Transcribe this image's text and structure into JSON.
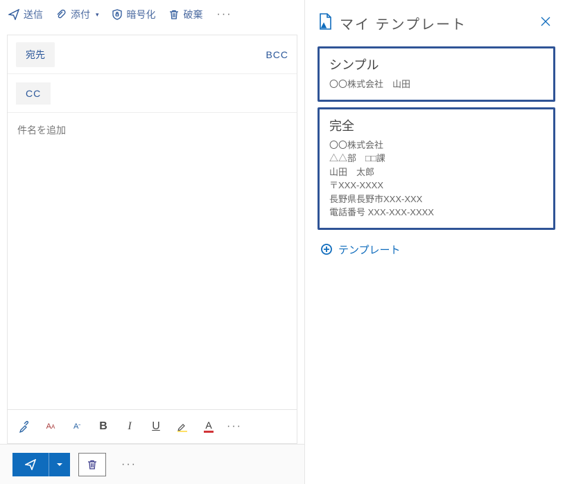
{
  "toolbar": {
    "send": "送信",
    "attach": "添付",
    "encrypt": "暗号化",
    "discard": "破棄"
  },
  "recipients": {
    "to_label": "宛先",
    "bcc_label": "BCC",
    "cc_label": "CC"
  },
  "subject_placeholder": "件名を追加",
  "format_buttons": {
    "bold": "B",
    "italic": "I",
    "underline": "U"
  },
  "templates_panel": {
    "title": "マイ テンプレート",
    "add_label": "テンプレート",
    "items": [
      {
        "name": "シンプル",
        "preview": "〇〇株式会社　山田"
      },
      {
        "name": "完全",
        "preview": "〇〇株式会社\n△△部　□□課\n山田　太郎\n〒XXX-XXXX\n長野県長野市XXX-XXX\n電話番号 XXX-XXX-XXXX"
      }
    ]
  }
}
